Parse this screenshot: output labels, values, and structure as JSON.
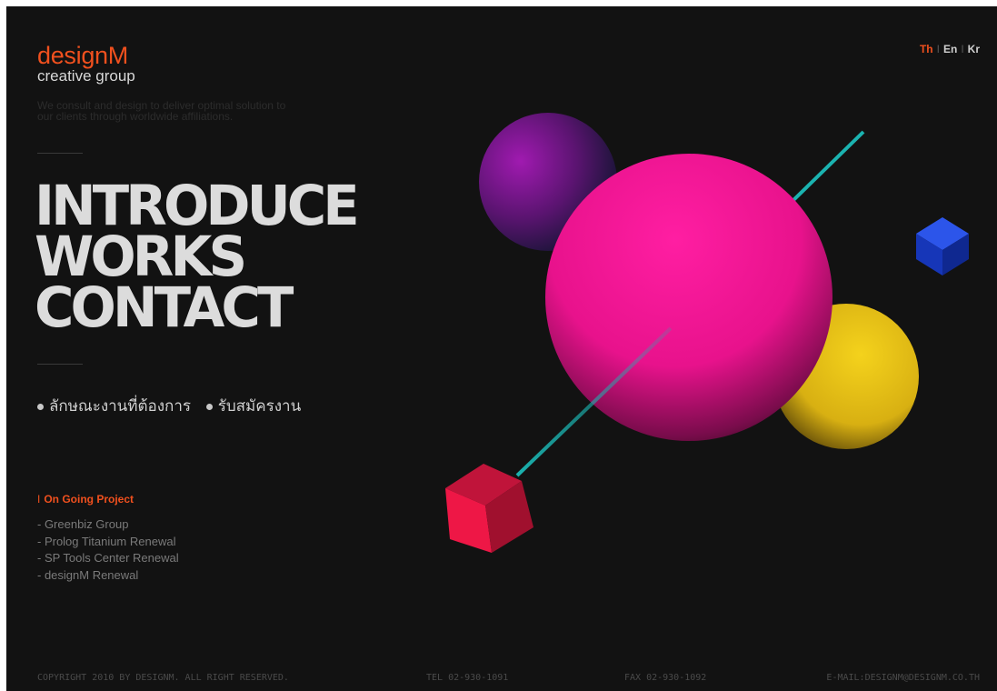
{
  "brand": {
    "name": "designM",
    "subtitle": "creative group",
    "tagline": "We consult and design to deliver optimal solution to our clients through worldwide affiliations."
  },
  "language": {
    "items": [
      "Th",
      "En",
      "Kr"
    ],
    "active": "Th",
    "separator": "I"
  },
  "main_nav": [
    "INTRODUCE",
    "WORKS",
    "CONTACT"
  ],
  "sub_nav": [
    "ลักษณะงานที่ต้องการ",
    "รับสมัครงาน"
  ],
  "projects": {
    "title": "On Going Project",
    "bar": "I",
    "items": [
      "- Greenbiz Group",
      "- Prolog Titanium Renewal",
      "- SP Tools Center Renewal",
      "- designM Renewal"
    ]
  },
  "footer": {
    "copyright": "COPYRIGHT 2010 BY DESIGNM. ALL RIGHT RESERVED.",
    "tel": "TEL 02-930-1091",
    "fax": "FAX 02-930-1092",
    "email": "E-MAIL:DESIGNM@DESIGNM.CO.TH"
  },
  "colors": {
    "background": "#121212",
    "accent": "#f0501e",
    "pink_sphere": "#ee1591",
    "purple_sphere": "#8a1a9c",
    "yellow_sphere": "#e6c21a",
    "blue_cube": "#1b3fd0",
    "red_cube": "#e0143c",
    "line": "#1bb3b0"
  }
}
